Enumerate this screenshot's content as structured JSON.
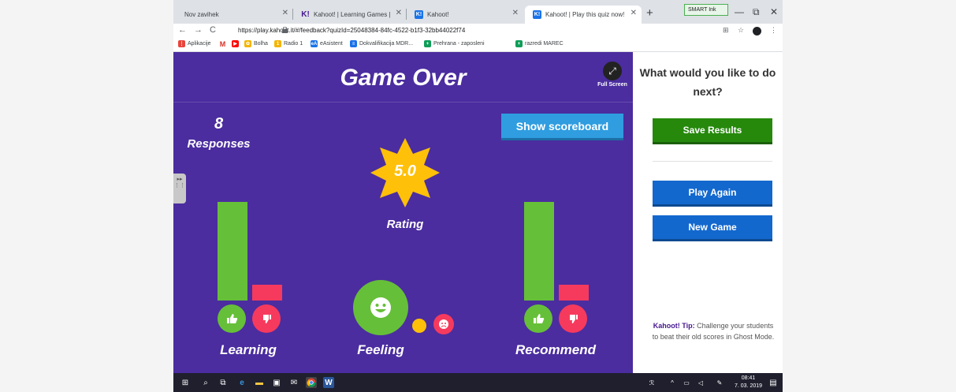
{
  "browser": {
    "tabs": [
      {
        "title": "Nov zavihek",
        "active": false,
        "favicon": "none"
      },
      {
        "title": "Kahoot! | Learning Games | Make",
        "active": false,
        "favicon": "kahoot-k-icon"
      },
      {
        "title": "Kahoot!",
        "active": false,
        "favicon": "kahoot-app-icon"
      },
      {
        "title": "Kahoot! | Play this quiz now!",
        "active": true,
        "favicon": "kahoot-app-icon"
      }
    ],
    "smart_ink": "SMART Ink",
    "url": "https://play.kahoot.it/#/feedback?quizId=25048384-84fc-4522-b1f3-32bb44022f74",
    "bookmarks": [
      {
        "label": "Aplikacije",
        "icon": "apps-grid-icon",
        "color": "#e8453c"
      },
      {
        "label": "",
        "icon": "gmail-icon",
        "color": "#d93025"
      },
      {
        "label": "",
        "icon": "youtube-icon",
        "color": "#ff0000"
      },
      {
        "label": "Bolha",
        "icon": "bolha-icon",
        "color": "#f4b400"
      },
      {
        "label": "Radio 1",
        "icon": "radio-icon",
        "color": "#f4b400"
      },
      {
        "label": "eAsistent",
        "icon": "easistent-icon",
        "color": "#1a73e8"
      },
      {
        "label": "Dokvalifikacija MDR...",
        "icon": "doc-icon",
        "color": "#1a73e8"
      },
      {
        "label": "Prehrana - zaposleni",
        "icon": "plus-icon",
        "color": "#0f9d58"
      },
      {
        "label": "razredi MAREC",
        "icon": "plus-icon",
        "color": "#0f9d58"
      }
    ]
  },
  "kahoot": {
    "title": "Game Over",
    "fullscreen_label": "Full Screen",
    "responses_count": "8",
    "responses_label": "Responses",
    "scoreboard_button": "Show scoreboard",
    "rating_value": "5.0",
    "rating_label": "Rating",
    "learning_label": "Learning",
    "feeling_label": "Feeling",
    "recommend_label": "Recommend",
    "learning": {
      "positive": 8,
      "negative": 0
    },
    "recommend": {
      "positive": 8,
      "negative": 0
    },
    "colors": {
      "bg": "#4b2d9f",
      "green": "#66bf39",
      "red": "#f63a5d",
      "yellow": "#ffc00a",
      "blue": "#2f9de0"
    }
  },
  "side_panel": {
    "title": "What would you like to do next?",
    "save_results": "Save Results",
    "play_again": "Play Again",
    "new_game": "New Game",
    "tip_label": "Kahoot! Tip:",
    "tip_text": "Challenge your students to beat their old scores in Ghost Mode."
  },
  "taskbar": {
    "time": "08:41",
    "date": "7. 03. 2019"
  }
}
